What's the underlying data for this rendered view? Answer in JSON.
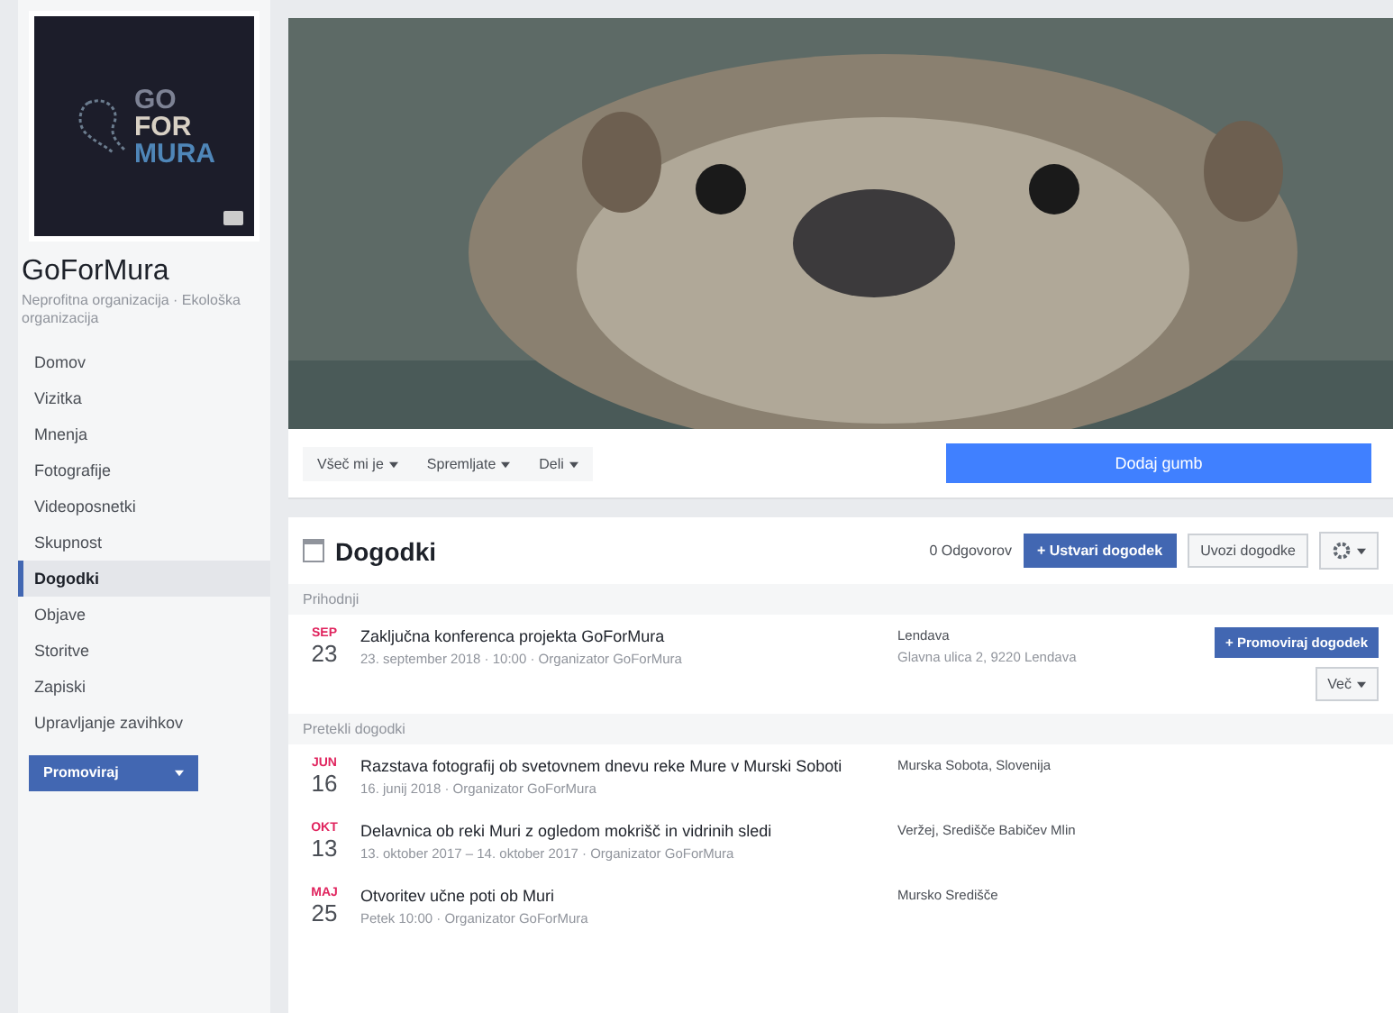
{
  "page": {
    "name": "GoForMura",
    "category": "Neprofitna organizacija · Ekološka organizacija"
  },
  "sidebar": {
    "items": [
      {
        "label": "Domov",
        "selected": false
      },
      {
        "label": "Vizitka",
        "selected": false
      },
      {
        "label": "Mnenja",
        "selected": false
      },
      {
        "label": "Fotografije",
        "selected": false
      },
      {
        "label": "Videoposnetki",
        "selected": false
      },
      {
        "label": "Skupnost",
        "selected": false
      },
      {
        "label": "Dogodki",
        "selected": true
      },
      {
        "label": "Objave",
        "selected": false
      },
      {
        "label": "Storitve",
        "selected": false
      },
      {
        "label": "Zapiski",
        "selected": false
      },
      {
        "label": "Upravljanje zavihkov",
        "selected": false
      }
    ],
    "promote": "Promoviraj"
  },
  "logo": {
    "line1": "GO",
    "line2": "FOR",
    "line3": "MURA"
  },
  "actions": [
    "Všeč mi je",
    "Spremljate",
    "Deli"
  ],
  "add_button": "Dodaj gumb",
  "events": {
    "title": "Dogodki",
    "count": "0 Odgovorov",
    "create": "+ Ustvari dogodek",
    "import": "Uvozi dogodke",
    "sections": [
      {
        "label": "Prihodnji",
        "items": [
          {
            "month": "SEP",
            "day": "23",
            "title": "Zaključna konferenca projekta GoForMura",
            "details": "23. september 2018 · 10:00 · Organizator GoForMura",
            "place": "Lendava",
            "place_detail": "Glavna ulica 2, 9220 Lendava",
            "promote": "+ Promoviraj dogodek",
            "more": "Več"
          }
        ]
      },
      {
        "label": "Pretekli dogodki",
        "items": [
          {
            "month": "JUN",
            "day": "16",
            "title": "Razstava fotografij ob svetovnem dnevu reke Mure v Murski Soboti",
            "details": "16. junij 2018 · Organizator GoForMura",
            "place": "Murska Sobota, Slovenija"
          },
          {
            "month": "OKT",
            "day": "13",
            "title": "Delavnica ob reki Muri z ogledom mokrišč in vidrinih sledi",
            "details": "13. oktober 2017 – 14. oktober 2017 · Organizator GoForMura",
            "place": "Veržej, Središče Babičev Mlin"
          },
          {
            "month": "MAJ",
            "day": "25",
            "title": "Otvoritev učne poti ob Muri",
            "details": "Petek 10:00 · Organizator GoForMura",
            "place": "Mursko Središče"
          }
        ]
      }
    ]
  }
}
